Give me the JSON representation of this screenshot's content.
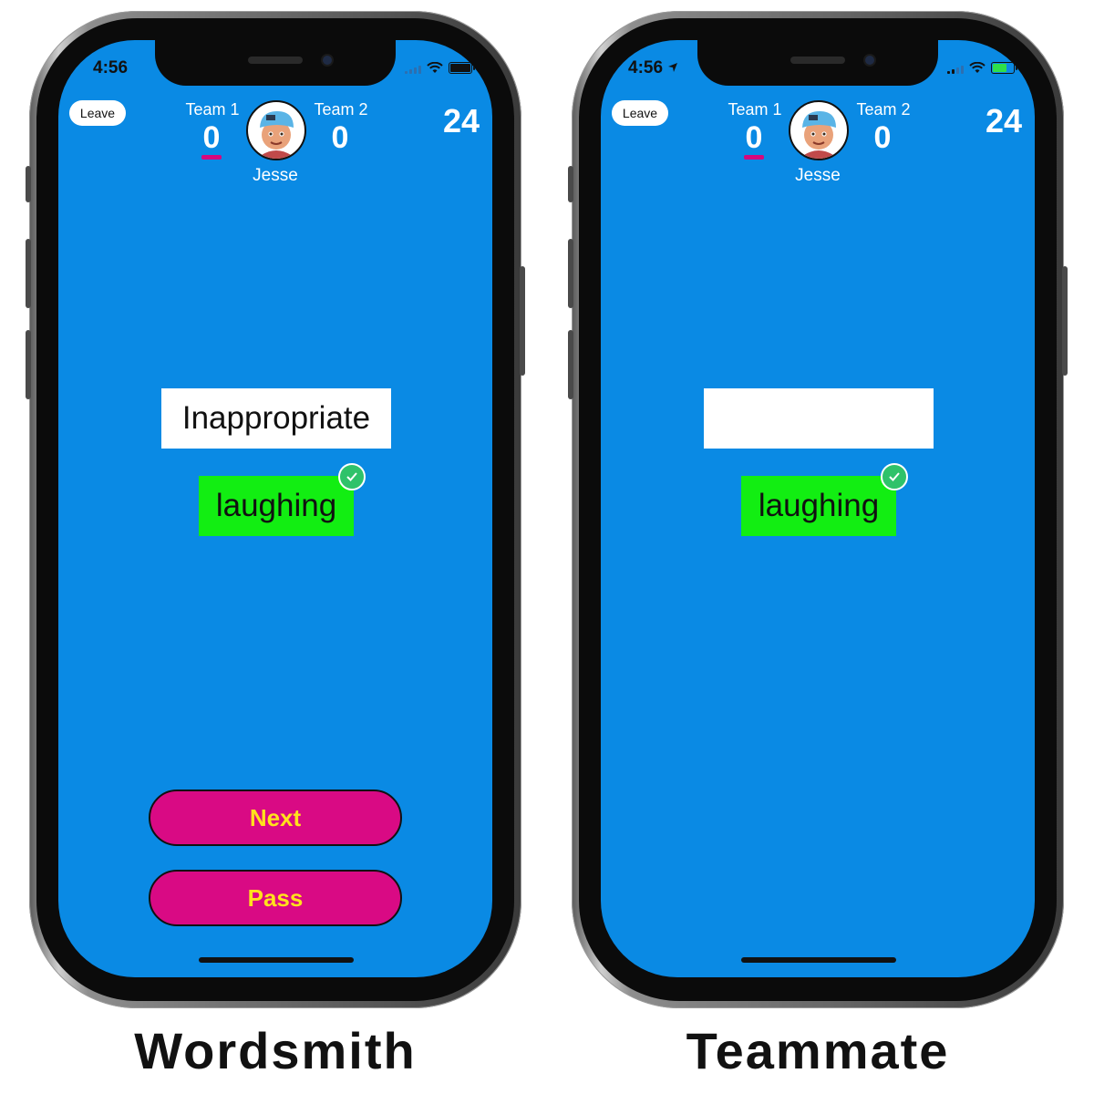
{
  "phones": [
    {
      "caption": "Wordsmith",
      "status": {
        "time": "4:56"
      },
      "leave_label": "Leave",
      "team1": {
        "label": "Team 1",
        "score": "0"
      },
      "team2": {
        "label": "Team 2",
        "score": "0"
      },
      "player_name": "Jesse",
      "timer": "24",
      "word": "Inappropriate",
      "guess": "laughing",
      "buttons": {
        "next": "Next",
        "pass": "Pass"
      }
    },
    {
      "caption": "Teammate",
      "status": {
        "time": "4:56"
      },
      "leave_label": "Leave",
      "team1": {
        "label": "Team 1",
        "score": "0"
      },
      "team2": {
        "label": "Team 2",
        "score": "0"
      },
      "player_name": "Jesse",
      "timer": "24",
      "word": "",
      "guess": "laughing"
    }
  ],
  "colors": {
    "background": "#0a8ae4",
    "button": "#d90a84",
    "button_text": "#ffe21c",
    "guess_bg": "#12ee12",
    "score_underline": "#d6087d"
  },
  "icons": [
    "wifi-icon",
    "battery-icon",
    "signal-icon",
    "location-arrow-icon",
    "check-icon",
    "avatar-icon"
  ]
}
